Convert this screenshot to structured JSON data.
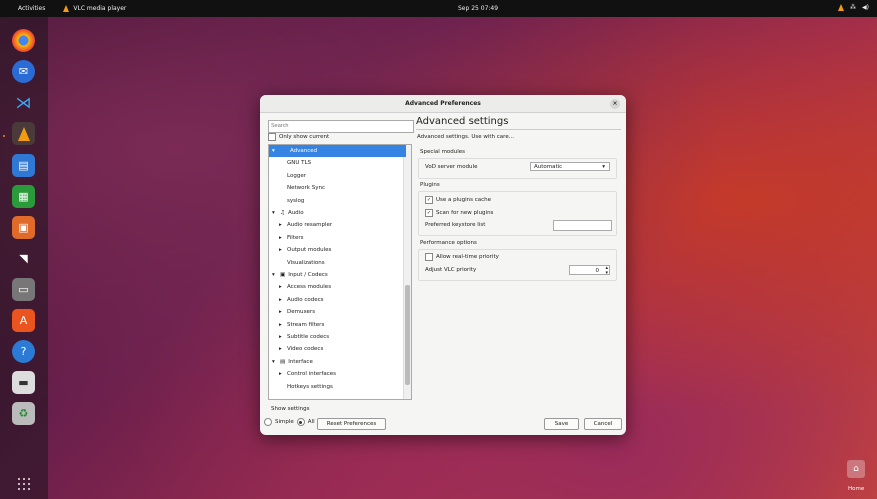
{
  "topbar": {
    "activities": "Activities",
    "app_name": "VLC media player",
    "clock": "Sep 25 07:49"
  },
  "dialog": {
    "title": "Advanced Preferences",
    "close_glyph": "×",
    "search_placeholder": "Search",
    "only_show_current": "Only show current",
    "tree": [
      {
        "label": "Advanced",
        "level": 0,
        "expander": "▾",
        "selected": true
      },
      {
        "label": "GNU TLS",
        "level": 1,
        "expander": ""
      },
      {
        "label": "Logger",
        "level": 1,
        "expander": ""
      },
      {
        "label": "Network Sync",
        "level": 1,
        "expander": ""
      },
      {
        "label": "syslog",
        "level": 1,
        "expander": ""
      },
      {
        "label": "Audio",
        "level": 0,
        "expander": "▾",
        "icon": "♫"
      },
      {
        "label": "Audio resampler",
        "level": 1,
        "expander": "▸"
      },
      {
        "label": "Filters",
        "level": 1,
        "expander": "▸"
      },
      {
        "label": "Output modules",
        "level": 1,
        "expander": "▸"
      },
      {
        "label": "Visualizations",
        "level": 1,
        "expander": ""
      },
      {
        "label": "Input / Codecs",
        "level": 0,
        "expander": "▾",
        "icon": "▣"
      },
      {
        "label": "Access modules",
        "level": 1,
        "expander": "▸"
      },
      {
        "label": "Audio codecs",
        "level": 1,
        "expander": "▸"
      },
      {
        "label": "Demuxers",
        "level": 1,
        "expander": "▸"
      },
      {
        "label": "Stream filters",
        "level": 1,
        "expander": "▸"
      },
      {
        "label": "Subtitle codecs",
        "level": 1,
        "expander": "▸"
      },
      {
        "label": "Video codecs",
        "level": 1,
        "expander": "▸"
      },
      {
        "label": "Interface",
        "level": 0,
        "expander": "▾",
        "icon": "▤"
      },
      {
        "label": "Control interfaces",
        "level": 1,
        "expander": "▸"
      },
      {
        "label": "Hotkeys settings",
        "level": 1,
        "expander": ""
      }
    ],
    "show_settings": "Show settings",
    "radio_simple": "Simple",
    "radio_all": "All",
    "reset_button": "Reset Preferences",
    "save_button": "Save",
    "cancel_button": "Cancel",
    "panel": {
      "heading": "Advanced settings",
      "subtitle": "Advanced settings. Use with care...",
      "special_modules": "Special modules",
      "vod_label": "VoD server module",
      "vod_value": "Automatic",
      "plugins": "Plugins",
      "use_cache": "Use a plugins cache",
      "scan_plugins": "Scan for new plugins",
      "keystore": "Preferred keystore list",
      "performance": "Performance options",
      "realtime": "Allow real-time priority",
      "priority_label": "Adjust VLC priority",
      "priority_value": "0"
    }
  },
  "desktop": {
    "home_label": "Home"
  },
  "colors": {
    "selection": "#3584e4",
    "vlc_orange": "#f39c12"
  }
}
